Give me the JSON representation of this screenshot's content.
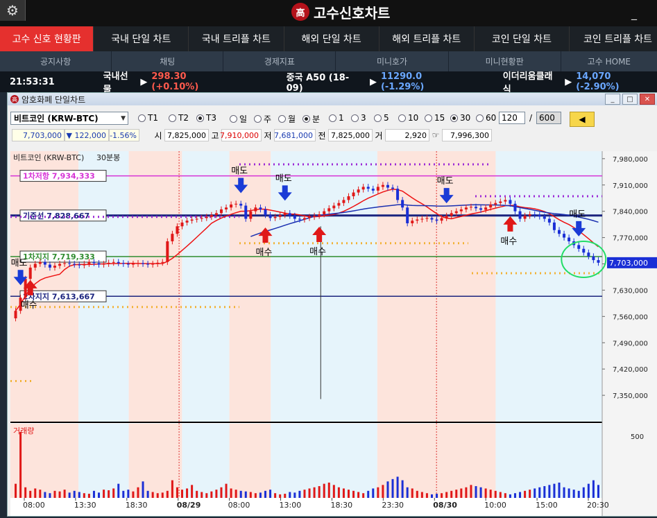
{
  "app": {
    "title": "고수신호차트",
    "logo_char": "高",
    "minimize_glyph": "_"
  },
  "nav_main": [
    "고수 신호 현황판",
    "국내 단일 차트",
    "국내 트리플 차트",
    "해외 단일 차트",
    "해외 트리플 차트",
    "코인 단일 차트",
    "코인 트리플 차트"
  ],
  "nav_sub": [
    "공지사항",
    "채팅",
    "경제지표",
    "미니호가",
    "미니현황판",
    "고수 HOME"
  ],
  "ticker": {
    "time": "21:53:31",
    "items": [
      {
        "name": "국내선물",
        "value": "298.30 (+0.10%)",
        "dir": "up"
      },
      {
        "name": "중국 A50 (18-09)",
        "value": "11290.0 (-1.29%)",
        "dir": "down"
      },
      {
        "name": "이더리움클래식",
        "value": "14,070 (-2.90%)",
        "dir": "down"
      }
    ]
  },
  "window": {
    "title": "암호화폐 단일차트"
  },
  "toolbar": {
    "symbol": "비트코인 (KRW-BTC)",
    "tick_types": [
      "T1",
      "T2",
      "T3"
    ],
    "tick_selected": "T3",
    "periods": [
      "일",
      "주",
      "월",
      "분"
    ],
    "period_selected": "분",
    "minutes": [
      "1",
      "3",
      "5",
      "10",
      "15",
      "30",
      "60"
    ],
    "minute_selected": "30",
    "count": "120",
    "slash": "/",
    "total": "600"
  },
  "quote": {
    "price": "7,703,000",
    "change": "▼ 122,000",
    "rate": "-1.56%",
    "open_label": "시",
    "open": "7,825,000",
    "high_label": "고",
    "high": "7,910,000",
    "low_label": "저",
    "low": "7,681,000",
    "prev_label": "전",
    "prev": "7,825,000",
    "vol_label": "거",
    "volume": "2,920",
    "extra": "7,996,300"
  },
  "chart_data": {
    "type": "candlestick",
    "title": "비트코인 (KRW-BTC) 30분봉",
    "symbol_label": "비트코인 (KRW-BTC)",
    "interval_label": "30분봉",
    "volume_label": "거래량",
    "y_ticks": [
      7980000,
      7910000,
      7840000,
      7770000,
      7700000,
      7630000,
      7560000,
      7490000,
      7420000,
      7350000
    ],
    "ylim": [
      7280000,
      8000000
    ],
    "volume_tick": "500",
    "x_ticks": [
      "08:00",
      "13:30",
      "18:30",
      "08/29",
      "08:00",
      "13:00",
      "18:30",
      "23:30",
      "08/30",
      "10:00",
      "15:00",
      "20:30"
    ],
    "current_price": "7,703,000",
    "levels": [
      {
        "label": "1차저항",
        "value": 7934333,
        "text": "7,934,333",
        "color": "#d633d6"
      },
      {
        "label": "기준선",
        "value": 7828667,
        "text": "7,828,667",
        "color": "#1a237e"
      },
      {
        "label": "1차지지",
        "value": 7719333,
        "text": "7,719,333",
        "color": "#2e8b2e"
      },
      {
        "label": "2차지지",
        "value": 7613667,
        "text": "7,613,667",
        "color": "#1a237e"
      }
    ],
    "signals": [
      {
        "type": "sell",
        "label": "매도",
        "index": 1
      },
      {
        "type": "buy",
        "label": "매수",
        "index": 3
      },
      {
        "type": "sell",
        "label": "매도",
        "index": 46
      },
      {
        "type": "buy",
        "label": "매수",
        "index": 51
      },
      {
        "type": "sell",
        "label": "매도",
        "index": 55
      },
      {
        "type": "buy",
        "label": "매수",
        "index": 62
      },
      {
        "type": "sell",
        "label": "매도",
        "index": 88
      },
      {
        "type": "buy",
        "label": "매수",
        "index": 101
      },
      {
        "type": "sell",
        "label": "매도",
        "index": 115
      }
    ],
    "closes": [
      7575000,
      7610000,
      7660000,
      7690000,
      7700000,
      7705000,
      7698000,
      7690000,
      7695000,
      7700000,
      7702000,
      7700000,
      7698000,
      7696000,
      7700000,
      7705000,
      7702000,
      7698000,
      7700000,
      7703000,
      7705000,
      7702000,
      7700000,
      7698000,
      7700000,
      7702000,
      7700000,
      7698000,
      7700000,
      7703000,
      7705000,
      7760000,
      7780000,
      7800000,
      7810000,
      7815000,
      7818000,
      7820000,
      7822000,
      7825000,
      7830000,
      7835000,
      7845000,
      7850000,
      7858000,
      7860000,
      7855000,
      7820000,
      7840000,
      7850000,
      7845000,
      7830000,
      7822000,
      7825000,
      7830000,
      7835000,
      7828000,
      7820000,
      7818000,
      7822000,
      7825000,
      7828000,
      7832000,
      7840000,
      7848000,
      7855000,
      7862000,
      7870000,
      7880000,
      7890000,
      7898000,
      7905000,
      7900000,
      7895000,
      7905000,
      7910000,
      7903000,
      7900000,
      7870000,
      7850000,
      7808000,
      7815000,
      7818000,
      7820000,
      7822000,
      7818000,
      7815000,
      7822000,
      7828000,
      7835000,
      7840000,
      7845000,
      7850000,
      7852000,
      7848000,
      7844000,
      7850000,
      7858000,
      7862000,
      7866000,
      7870000,
      7860000,
      7840000,
      7820000,
      7828000,
      7832000,
      7830000,
      7826000,
      7820000,
      7810000,
      7790000,
      7780000,
      7770000,
      7760000,
      7750000,
      7740000,
      7730000,
      7720000,
      7710000,
      7703000
    ],
    "volumes": [
      120,
      560,
      90,
      60,
      80,
      70,
      50,
      40,
      60,
      55,
      70,
      45,
      60,
      50,
      40,
      35,
      60,
      45,
      70,
      65,
      80,
      120,
      60,
      70,
      55,
      90,
      140,
      60,
      50,
      40,
      45,
      60,
      150,
      90,
      70,
      80,
      110,
      60,
      50,
      40,
      55,
      70,
      90,
      120,
      80,
      70,
      60,
      55,
      50,
      40,
      45,
      60,
      70,
      40,
      30,
      35,
      50,
      45,
      60,
      70,
      80,
      90,
      100,
      120,
      130,
      110,
      90,
      80,
      70,
      60,
      50,
      40,
      60,
      80,
      90,
      110,
      140,
      160,
      180,
      150,
      90,
      80,
      60,
      50,
      40,
      30,
      35,
      40,
      50,
      60,
      70,
      80,
      90,
      110,
      100,
      90,
      80,
      70,
      60,
      50,
      40,
      30,
      40,
      50,
      60,
      70,
      80,
      90,
      100,
      110,
      120,
      130,
      90,
      80,
      70,
      60,
      90,
      120,
      150,
      110
    ]
  }
}
